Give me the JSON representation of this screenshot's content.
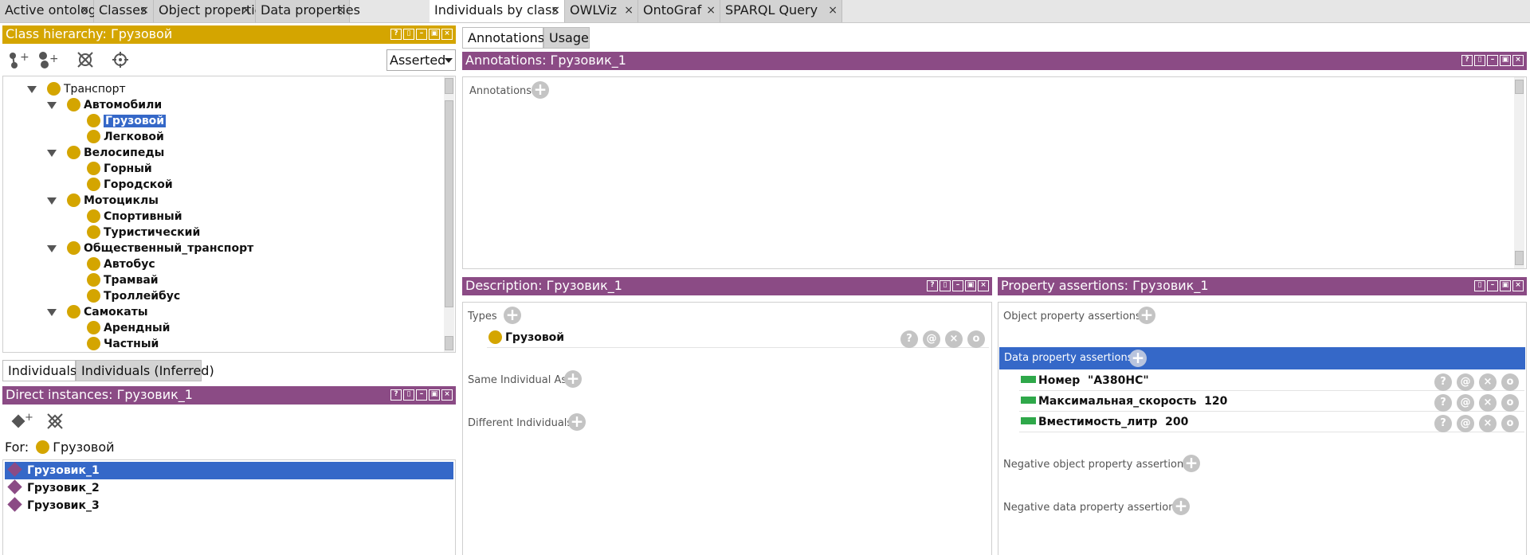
{
  "tabs": [
    {
      "label": "Active ontology",
      "active": false
    },
    {
      "label": "Classes",
      "active": false
    },
    {
      "label": "Object properties",
      "active": false
    },
    {
      "label": "Data properties",
      "active": false
    },
    {
      "label": "Individuals by class",
      "active": true
    },
    {
      "label": "OWLViz",
      "active": false
    },
    {
      "label": "OntoGraf",
      "active": false
    },
    {
      "label": "SPARQL Query",
      "active": false
    }
  ],
  "tab_close": "×",
  "class_hierarchy": {
    "title": "Class hierarchy: Грузовой",
    "mode": "Asserted",
    "items": [
      {
        "label": "Транспорт",
        "level": 1,
        "bold": false
      },
      {
        "label": "Автомобили",
        "level": 2,
        "bold": true
      },
      {
        "label": "Грузовой",
        "level": 3,
        "bold": true,
        "selected": true
      },
      {
        "label": "Легковой",
        "level": 3,
        "bold": true
      },
      {
        "label": "Велосипеды",
        "level": 2,
        "bold": true
      },
      {
        "label": "Горный",
        "level": 3,
        "bold": true
      },
      {
        "label": "Городской",
        "level": 3,
        "bold": true
      },
      {
        "label": "Мотоциклы",
        "level": 2,
        "bold": true
      },
      {
        "label": "Спортивный",
        "level": 3,
        "bold": true
      },
      {
        "label": "Туристический",
        "level": 3,
        "bold": true
      },
      {
        "label": "Общественный_транспорт",
        "level": 2,
        "bold": true
      },
      {
        "label": "Автобус",
        "level": 3,
        "bold": true
      },
      {
        "label": "Трамвай",
        "level": 3,
        "bold": true
      },
      {
        "label": "Троллейбус",
        "level": 3,
        "bold": true
      },
      {
        "label": "Самокаты",
        "level": 2,
        "bold": true
      },
      {
        "label": "Арендный",
        "level": 3,
        "bold": true
      },
      {
        "label": "Частный",
        "level": 3,
        "bold": true
      }
    ]
  },
  "individual_tabs": [
    {
      "label": "Individuals",
      "active": true
    },
    {
      "label": "Individuals (Inferred)",
      "active": false
    }
  ],
  "direct_instances": {
    "title": "Direct instances: Грузовик_1",
    "for_label": "For:",
    "for_class": "Грузовой",
    "items": [
      {
        "label": "Грузовик_1",
        "selected": true
      },
      {
        "label": "Грузовик_2",
        "selected": false
      },
      {
        "label": "Грузовик_3",
        "selected": false
      }
    ]
  },
  "right_tabs": [
    {
      "label": "Annotations",
      "active": true
    },
    {
      "label": "Usage",
      "active": false
    }
  ],
  "annotations": {
    "title": "Annotations: Грузовик_1",
    "section_label": "Annotations"
  },
  "description": {
    "title": "Description: Грузовик_1",
    "types_label": "Types",
    "type_value": "Грузовой",
    "same_label": "Same Individual As",
    "different_label": "Different Individuals"
  },
  "property_assertions": {
    "title": "Property assertions: Грузовик_1",
    "object_label": "Object property assertions",
    "data_label": "Data property assertions",
    "data_items": [
      {
        "property": "Номер",
        "value": "\"А380НС\""
      },
      {
        "property": "Максимальная_скорость",
        "value": "120"
      },
      {
        "property": "Вместимость_литр",
        "value": "200"
      }
    ],
    "neg_object_label": "Negative object property assertions",
    "neg_data_label": "Negative data property assertions"
  },
  "row_action_glyphs": [
    "?",
    "@",
    "×",
    "o"
  ],
  "window_glyphs": [
    "?",
    "▯",
    "–",
    "▣",
    "×"
  ]
}
